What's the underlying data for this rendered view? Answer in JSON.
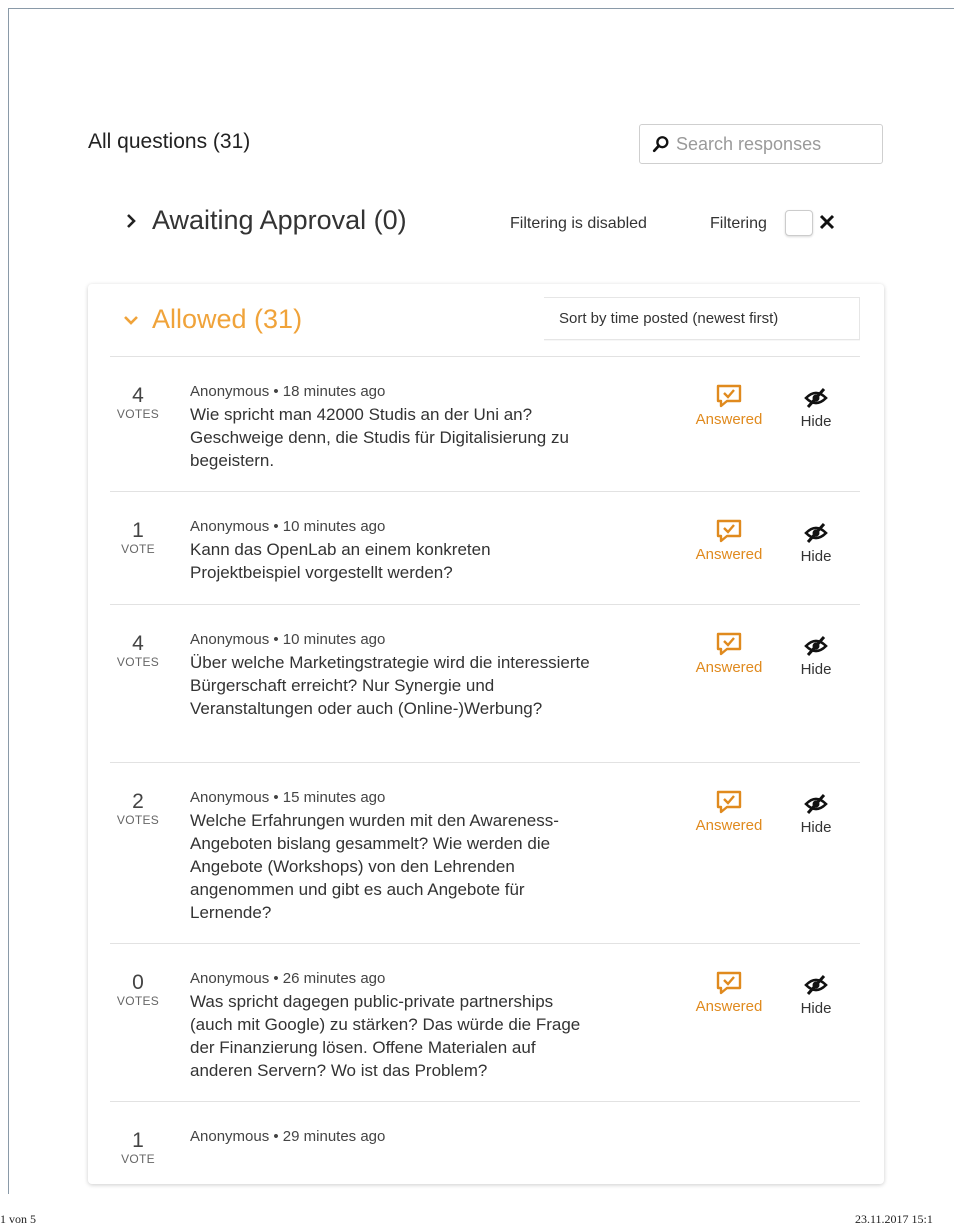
{
  "header": {
    "title": "All questions (31)",
    "search_placeholder": "Search responses",
    "search_icon": "search-icon"
  },
  "awaiting": {
    "label": "Awaiting Approval (0)",
    "filter_note": "Filtering is disabled",
    "filter_label": "Filtering"
  },
  "allowed": {
    "label": "Allowed (31)",
    "sort_label": "Sort by time posted (newest first)"
  },
  "actions": {
    "answered_label": "Answered",
    "hide_label": "Hide"
  },
  "colors": {
    "accent": "#f0a33a",
    "answered": "#e08a1e"
  },
  "questions": [
    {
      "votes": "4",
      "unit": "VOTES",
      "meta": "Anonymous  •  18 minutes ago",
      "text": "Wie spricht man 42000 Studis an der Uni an? Geschweige denn, die Studis für Digitalisierung zu begeistern."
    },
    {
      "votes": "1",
      "unit": "VOTE",
      "meta": "Anonymous  •  10 minutes ago",
      "text": "Kann das OpenLab an einem konkreten Projektbeispiel vorgestellt werden?"
    },
    {
      "votes": "4",
      "unit": "VOTES",
      "meta": "Anonymous  •  10 minutes ago",
      "text": "Über welche Marketingstrategie wird die interessierte Bürgerschaft erreicht? Nur Synergie und Veranstaltungen oder auch (Online-)Werbung?"
    },
    {
      "votes": "2",
      "unit": "VOTES",
      "meta": "Anonymous  •  15 minutes ago",
      "text": "Welche Erfahrungen wurden mit den Awareness-Angeboten bislang gesammelt? Wie werden die Angebote (Workshops) von den Lehrenden angenommen und gibt es auch Angebote für Lernende?"
    },
    {
      "votes": "0",
      "unit": "VOTES",
      "meta": "Anonymous  •  26 minutes ago",
      "text": "Was spricht dagegen public-private partnerships (auch mit Google) zu stärken? Das würde die Frage der Finanzierung lösen. Offene Materialen auf anderen Servern? Wo ist das Problem?"
    },
    {
      "votes": "1",
      "unit": "VOTE",
      "meta": "Anonymous  •  29 minutes ago",
      "text": ""
    }
  ],
  "footer": {
    "page": "1 von 5",
    "datetime": "23.11.2017 15:1"
  }
}
